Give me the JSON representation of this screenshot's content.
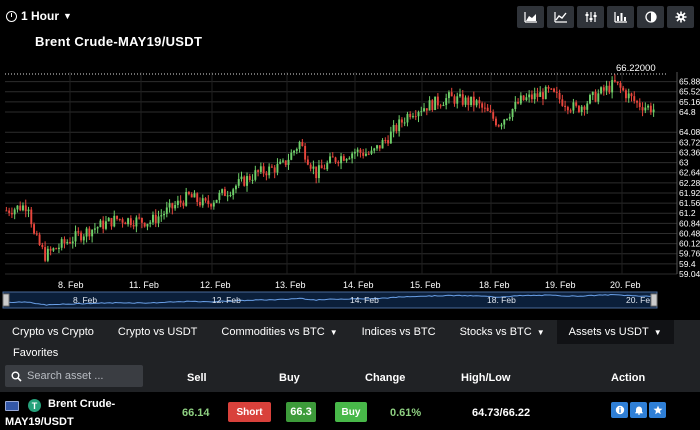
{
  "toolbar": {
    "timeframe": "1 Hour",
    "tools": [
      {
        "name": "area-chart-icon"
      },
      {
        "name": "line-chart-icon"
      },
      {
        "name": "indicators-icon"
      },
      {
        "name": "bar-chart-icon"
      },
      {
        "name": "theme-toggle-icon"
      },
      {
        "name": "settings-gear-icon"
      }
    ]
  },
  "chart_title": "Brent Crude-MAY19/USDT",
  "chart_data": {
    "type": "candlestick",
    "y_ticks": [
      "65.88",
      "65.52",
      "65.16",
      "64.8",
      "64.08",
      "63.72",
      "63.36",
      "63",
      "62.64",
      "62.28",
      "61.92",
      "61.56",
      "61.2",
      "60.84",
      "60.48",
      "60.12",
      "59.76",
      "59.4",
      "59.04"
    ],
    "ylim": [
      59.04,
      66.22
    ],
    "x_ticks": [
      "8. Feb",
      "11. Feb",
      "12. Feb",
      "13. Feb",
      "14. Feb",
      "15. Feb",
      "18. Feb",
      "19. Feb",
      "20. Feb"
    ],
    "max_marker": "66.22000",
    "grid": true,
    "up_color": "#6fd06a",
    "down_color": "#e8463c",
    "navigator_ticks": [
      "8. Feb",
      "12. Feb",
      "14. Feb",
      "18. Feb",
      "20. Fe"
    ],
    "trend_keypoints": [
      [
        0,
        61.3
      ],
      [
        8,
        61.5
      ],
      [
        10,
        60.4
      ],
      [
        14,
        59.7
      ],
      [
        22,
        60.2
      ],
      [
        30,
        60.6
      ],
      [
        40,
        61.0
      ],
      [
        52,
        60.9
      ],
      [
        60,
        61.4
      ],
      [
        66,
        61.8
      ],
      [
        72,
        61.5
      ],
      [
        80,
        62.0
      ],
      [
        90,
        62.6
      ],
      [
        100,
        62.9
      ],
      [
        106,
        63.7
      ],
      [
        112,
        62.6
      ],
      [
        118,
        63.1
      ],
      [
        126,
        63.4
      ],
      [
        132,
        63.3
      ],
      [
        138,
        63.9
      ],
      [
        146,
        64.8
      ],
      [
        160,
        65.3
      ],
      [
        170,
        65.1
      ],
      [
        178,
        64.4
      ],
      [
        186,
        65.2
      ],
      [
        196,
        65.5
      ],
      [
        206,
        64.9
      ],
      [
        212,
        65.3
      ],
      [
        220,
        65.8
      ],
      [
        228,
        65.1
      ],
      [
        234,
        64.9
      ]
    ]
  },
  "categories": [
    {
      "label": "Crypto vs Crypto",
      "dropdown": false,
      "active": false
    },
    {
      "label": "Crypto vs USDT",
      "dropdown": false,
      "active": false
    },
    {
      "label": "Commodities vs BTC",
      "dropdown": true,
      "active": false
    },
    {
      "label": "Indices vs BTC",
      "dropdown": false,
      "active": false
    },
    {
      "label": "Stocks vs BTC",
      "dropdown": true,
      "active": false
    },
    {
      "label": "Assets vs USDT",
      "dropdown": true,
      "active": true
    }
  ],
  "favorites_label": "Favorites",
  "search": {
    "placeholder": "Search asset ..."
  },
  "table": {
    "headers": {
      "sell": "Sell",
      "buy": "Buy",
      "change": "Change",
      "highlow": "High/Low",
      "action": "Action"
    },
    "row": {
      "name_line1": "Brent Crude-",
      "name_line2": "MAY19/USDT",
      "sell": "66.14",
      "short_label": "Short",
      "buy": "66.3",
      "buy_label": "Buy",
      "change": "0.61%",
      "highlow": "64.73/66.22"
    }
  }
}
